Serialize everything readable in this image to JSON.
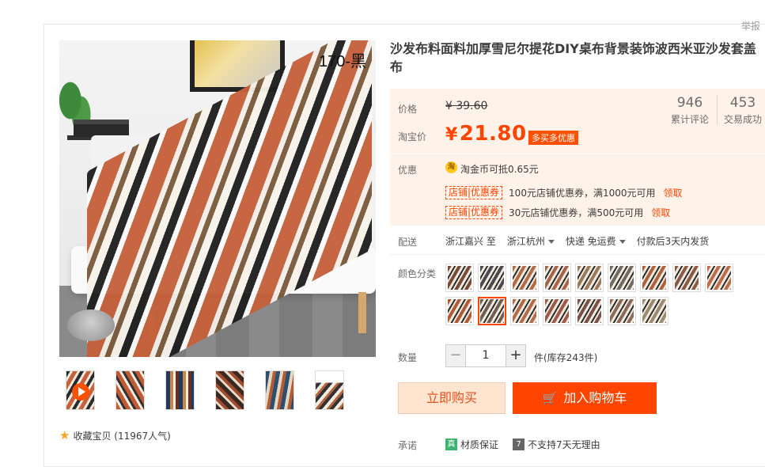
{
  "report": "举报",
  "image": {
    "label": "170-黑"
  },
  "favorite": {
    "text": "收藏宝贝 (11967人气)"
  },
  "product": {
    "title": "沙发布料面料加厚雪尼尔提花DIY桌布背景装饰波西米亚沙发套盖布"
  },
  "price": {
    "label": "价格",
    "original": "¥ 39.60",
    "tb_label": "淘宝价",
    "yen": "¥",
    "current": "21.80",
    "promo_tag": "多买多优惠"
  },
  "stats": {
    "reviews_count": "946",
    "reviews_label": "累计评论",
    "deals_count": "453",
    "deals_label": "交易成功"
  },
  "promo": {
    "label": "优惠",
    "coin_icon_text": "淘",
    "coin_text": "淘金币可抵0.65元",
    "coupons": [
      {
        "tag": "店铺|优惠券",
        "text": "100元店铺优惠券，满1000元可用",
        "action": "领取"
      },
      {
        "tag": "店铺|优惠券",
        "text": "30元店铺优惠券，满500元可用",
        "action": "领取"
      }
    ]
  },
  "shipping": {
    "label": "配送",
    "from": "浙江嘉兴 至",
    "to": "浙江杭州",
    "method": "快递 免运费",
    "time": "付款后3天内发货"
  },
  "color": {
    "label": "颜色分类",
    "selected_index": 10,
    "swatch_colors": [
      "#7a4a38",
      "#4a4a52",
      "#b36a45",
      "#a86248",
      "#9a7a5a",
      "#6f6a62",
      "#b0603c",
      "#8a5a44",
      "#c06a4a",
      "#b05a38",
      "#705e52",
      "#b46a48",
      "#a0584a",
      "#7a5048",
      "#8a6a5a",
      "#9a8a70"
    ]
  },
  "quantity": {
    "label": "数量",
    "minus": "−",
    "value": "1",
    "plus": "+",
    "stock": "件(库存243件)"
  },
  "actions": {
    "buy_now": "立即购买",
    "add_cart": "加入购物车"
  },
  "promise": {
    "label": "承诺",
    "g_icon": "真",
    "g_text": "材质保证",
    "d_icon": "7",
    "d_text": "不支持7天无理由"
  }
}
